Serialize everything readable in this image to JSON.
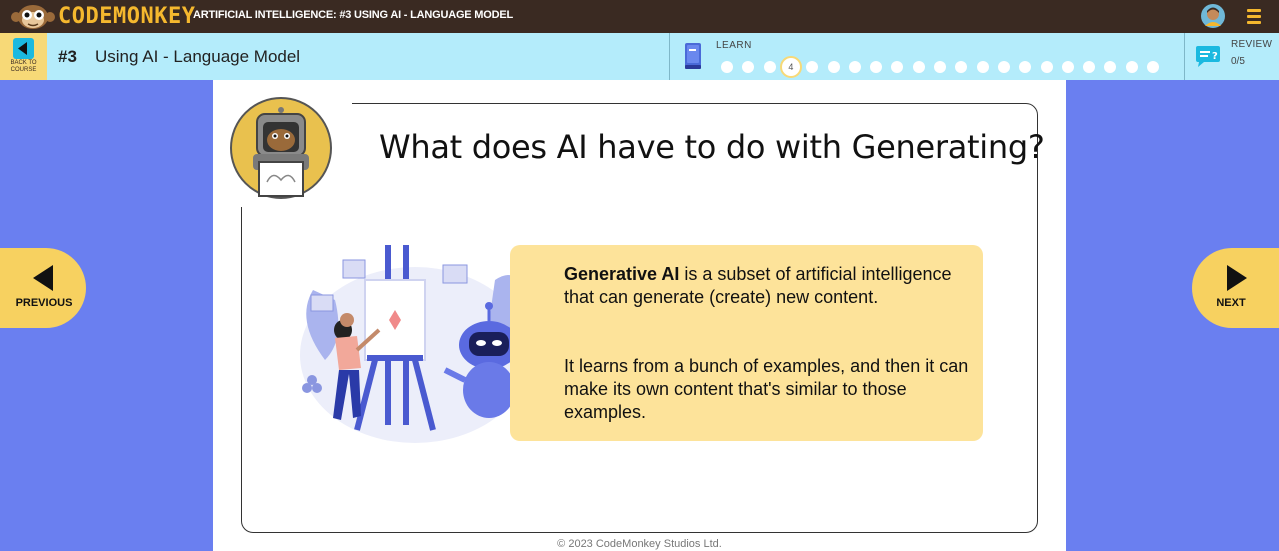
{
  "header": {
    "logo_text": "CODEMONKEY",
    "course_title": "ARTIFICIAL INTELLIGENCE: #3 USING AI - LANGUAGE MODEL",
    "avatar_icon": "user-avatar-icon",
    "menu_icon": "hamburger-menu-icon"
  },
  "lesson_bar": {
    "back_label_line1": "BACK TO",
    "back_label_line2": "COURSE",
    "lesson_number": "#3",
    "lesson_name": "Using AI - Language Model",
    "learn_label": "LEARN",
    "current_step": "4",
    "total_steps": 21,
    "review_label": "REVIEW",
    "review_count": "0/5"
  },
  "slide": {
    "title": "What does AI have to do with Generating?",
    "p1_bold": "Generative AI",
    "p1_rest": " is a subset of artificial intelligence that can generate (create) new content.",
    "p2": "It learns from a bunch of examples, and then it can make its own content that's similar to those examples.",
    "copyright": "© 2023 CodeMonkey Studios Ltd."
  },
  "navigation": {
    "previous_label": "PREVIOUS",
    "next_label": "NEXT"
  },
  "colors": {
    "topbar": "#3a2a22",
    "lessonbar": "#b4ecfb",
    "background": "#6a7ff0",
    "accent_yellow": "#f7d160",
    "info_box": "#fde39a"
  }
}
